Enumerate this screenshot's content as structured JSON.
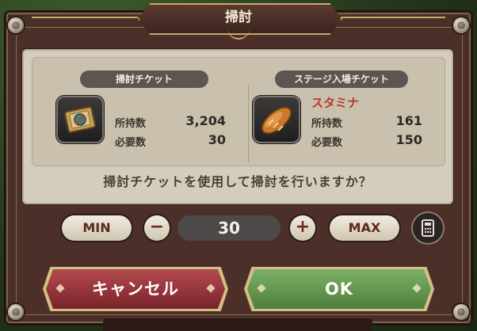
{
  "dialog": {
    "title": "掃討",
    "question": "掃討チケットを使用して掃討を行いますか？"
  },
  "sweep_ticket": {
    "header": "掃討チケット",
    "owned_label": "所持数",
    "owned_value": "3,204",
    "required_label": "必要数",
    "required_value": "30"
  },
  "stage_ticket": {
    "header": "ステージ入場チケット",
    "name": "スタミナ",
    "owned_label": "所持数",
    "owned_value": "161",
    "required_label": "必要数",
    "required_value": "150"
  },
  "quantity": {
    "min_label": "MIN",
    "max_label": "MAX",
    "minus_label": "−",
    "plus_label": "+",
    "value": "30"
  },
  "actions": {
    "cancel_label": "キャンセル",
    "ok_label": "OK"
  },
  "colors": {
    "frame": "#4a2f28",
    "panel": "#d4cdbb",
    "cancel": "#9a353c",
    "ok": "#65984f",
    "stamina_text": "#b73b2a"
  },
  "icons": {
    "sweep_ticket": "ticket-icon",
    "stamina": "bread-icon",
    "calculator": "calculator-icon"
  }
}
